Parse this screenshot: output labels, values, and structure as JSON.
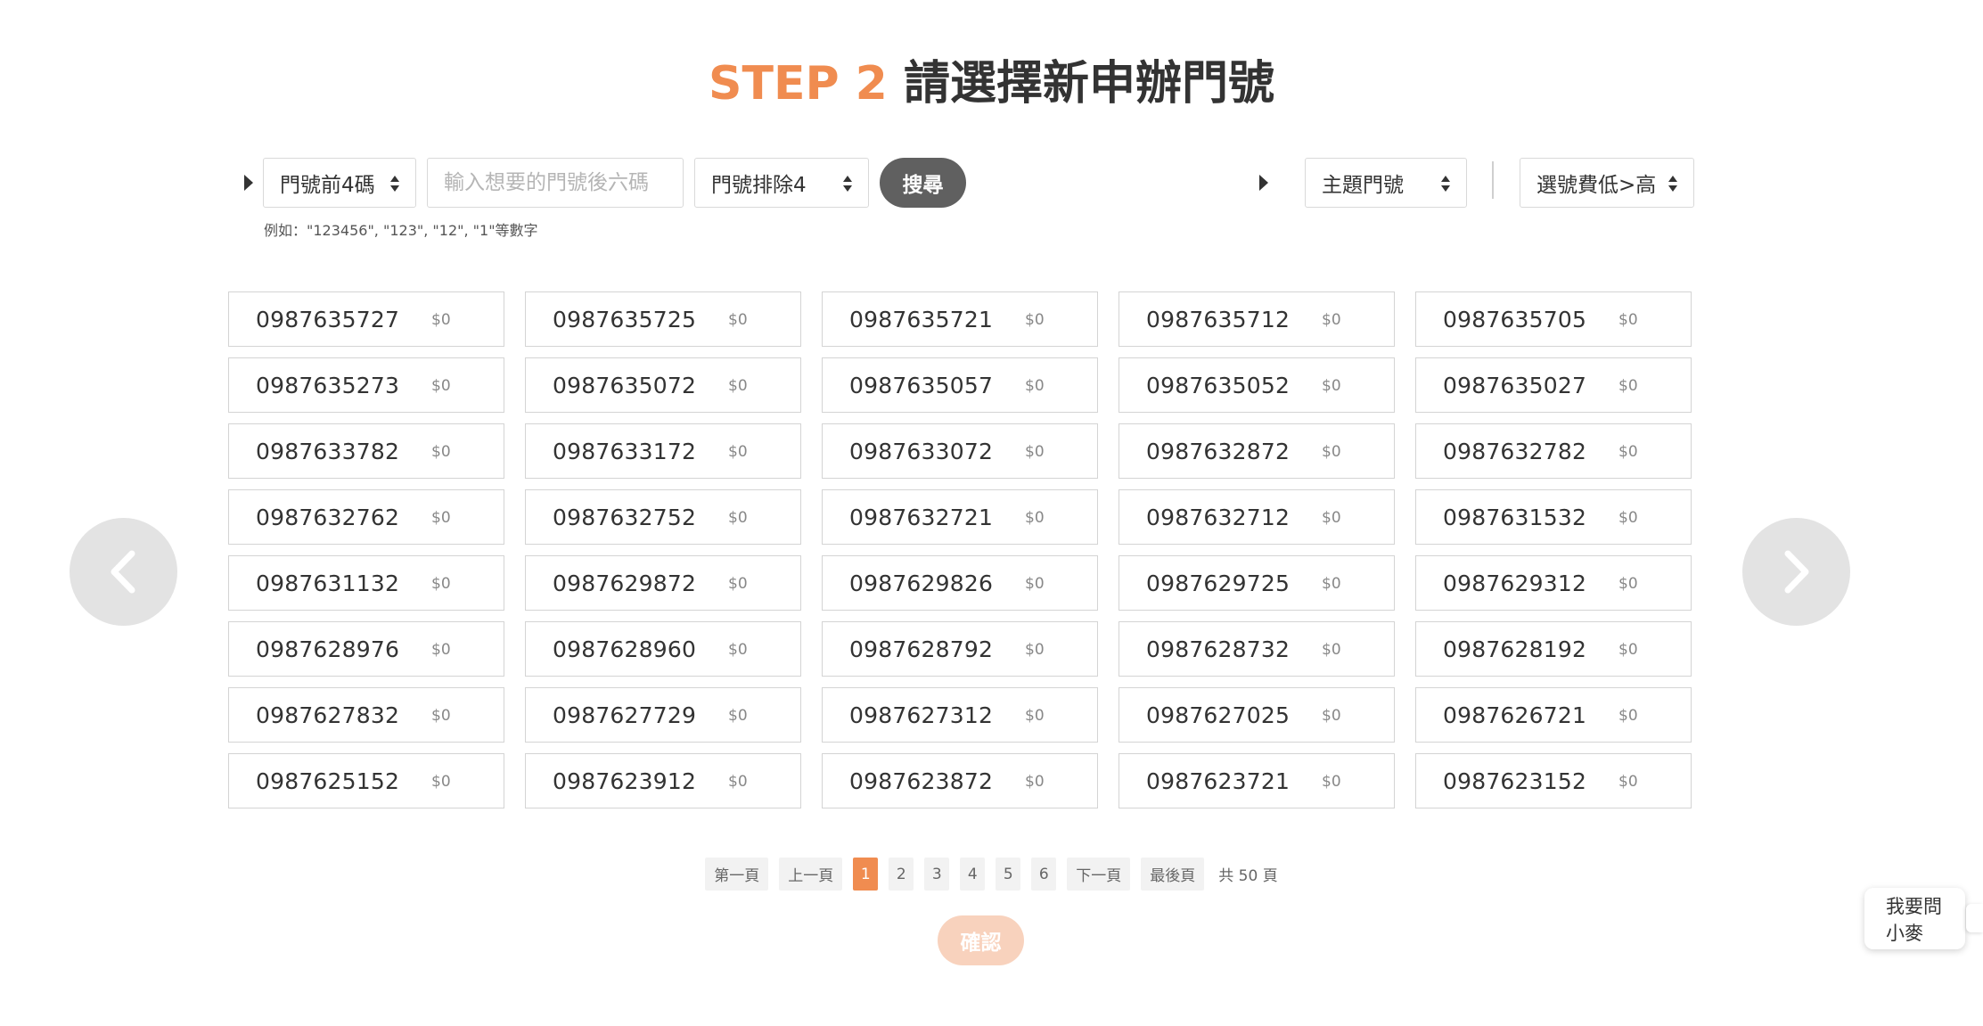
{
  "header": {
    "step": "STEP 2",
    "title": "請選擇新申辦門號"
  },
  "filters": {
    "prefix_select": "門號前4碼",
    "search_placeholder": "輸入想要的門號後六碼",
    "exclude_select": "門號排除4",
    "search_button": "搜尋",
    "hint": "例如：\"123456\", \"123\", \"12\", \"1\"等數字",
    "theme_select": "主題門號",
    "sort_select": "選號費低>高"
  },
  "numbers": [
    {
      "number": "0987635727",
      "price": "$0"
    },
    {
      "number": "0987635725",
      "price": "$0"
    },
    {
      "number": "0987635721",
      "price": "$0"
    },
    {
      "number": "0987635712",
      "price": "$0"
    },
    {
      "number": "0987635705",
      "price": "$0"
    },
    {
      "number": "0987635273",
      "price": "$0"
    },
    {
      "number": "0987635072",
      "price": "$0"
    },
    {
      "number": "0987635057",
      "price": "$0"
    },
    {
      "number": "0987635052",
      "price": "$0"
    },
    {
      "number": "0987635027",
      "price": "$0"
    },
    {
      "number": "0987633782",
      "price": "$0"
    },
    {
      "number": "0987633172",
      "price": "$0"
    },
    {
      "number": "0987633072",
      "price": "$0"
    },
    {
      "number": "0987632872",
      "price": "$0"
    },
    {
      "number": "0987632782",
      "price": "$0"
    },
    {
      "number": "0987632762",
      "price": "$0"
    },
    {
      "number": "0987632752",
      "price": "$0"
    },
    {
      "number": "0987632721",
      "price": "$0"
    },
    {
      "number": "0987632712",
      "price": "$0"
    },
    {
      "number": "0987631532",
      "price": "$0"
    },
    {
      "number": "0987631132",
      "price": "$0"
    },
    {
      "number": "0987629872",
      "price": "$0"
    },
    {
      "number": "0987629826",
      "price": "$0"
    },
    {
      "number": "0987629725",
      "price": "$0"
    },
    {
      "number": "0987629312",
      "price": "$0"
    },
    {
      "number": "0987628976",
      "price": "$0"
    },
    {
      "number": "0987628960",
      "price": "$0"
    },
    {
      "number": "0987628792",
      "price": "$0"
    },
    {
      "number": "0987628732",
      "price": "$0"
    },
    {
      "number": "0987628192",
      "price": "$0"
    },
    {
      "number": "0987627832",
      "price": "$0"
    },
    {
      "number": "0987627729",
      "price": "$0"
    },
    {
      "number": "0987627312",
      "price": "$0"
    },
    {
      "number": "0987627025",
      "price": "$0"
    },
    {
      "number": "0987626721",
      "price": "$0"
    },
    {
      "number": "0987625152",
      "price": "$0"
    },
    {
      "number": "0987623912",
      "price": "$0"
    },
    {
      "number": "0987623872",
      "price": "$0"
    },
    {
      "number": "0987623721",
      "price": "$0"
    },
    {
      "number": "0987623152",
      "price": "$0"
    }
  ],
  "pagination": {
    "first": "第一頁",
    "prev": "上一頁",
    "pages": [
      "1",
      "2",
      "3",
      "4",
      "5",
      "6"
    ],
    "current_page": "1",
    "next": "下一頁",
    "last": "最後頁",
    "total": "共 50 頁"
  },
  "confirm_button": "確認",
  "chat": {
    "line1": "我要問",
    "line2": "小麥"
  },
  "colors": {
    "accent": "#f08c50",
    "search_button": "#606060",
    "confirm_disabled": "#f8d2bd"
  },
  "icons": {
    "prev": "chevron-left-icon",
    "next": "chevron-right-icon",
    "filter_marker": "caret-right-icon"
  }
}
